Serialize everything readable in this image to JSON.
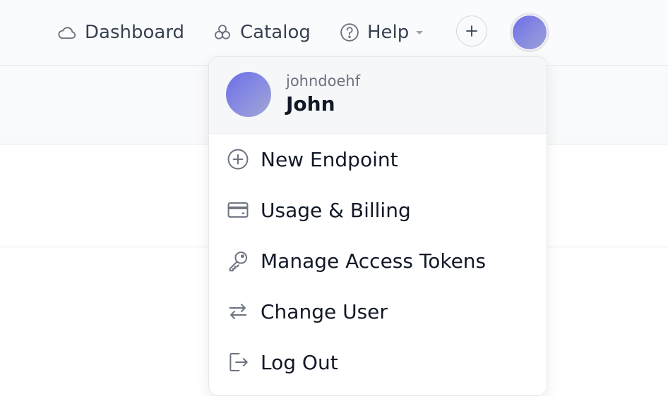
{
  "nav": {
    "dashboard": {
      "label": "Dashboard",
      "icon": "cloud-icon"
    },
    "catalog": {
      "label": "Catalog",
      "icon": "catalog-icon"
    },
    "help": {
      "label": "Help",
      "icon": "help-circle-icon"
    },
    "add_button_icon": "plus-icon",
    "avatar_icon": "user-avatar"
  },
  "menu": {
    "username": "johndoehf",
    "name": "John",
    "items": [
      {
        "label": "New Endpoint",
        "icon": "plus-circle-icon"
      },
      {
        "label": "Usage & Billing",
        "icon": "credit-card-icon"
      },
      {
        "label": "Manage Access Tokens",
        "icon": "key-icon"
      },
      {
        "label": "Change User",
        "icon": "switch-arrows-icon"
      },
      {
        "label": "Log Out",
        "icon": "logout-icon"
      }
    ]
  },
  "colors": {
    "avatar_gradient_start": "#6d6ee6",
    "avatar_gradient_end": "#a3a7d4",
    "icon_gray": "#6b7280"
  }
}
